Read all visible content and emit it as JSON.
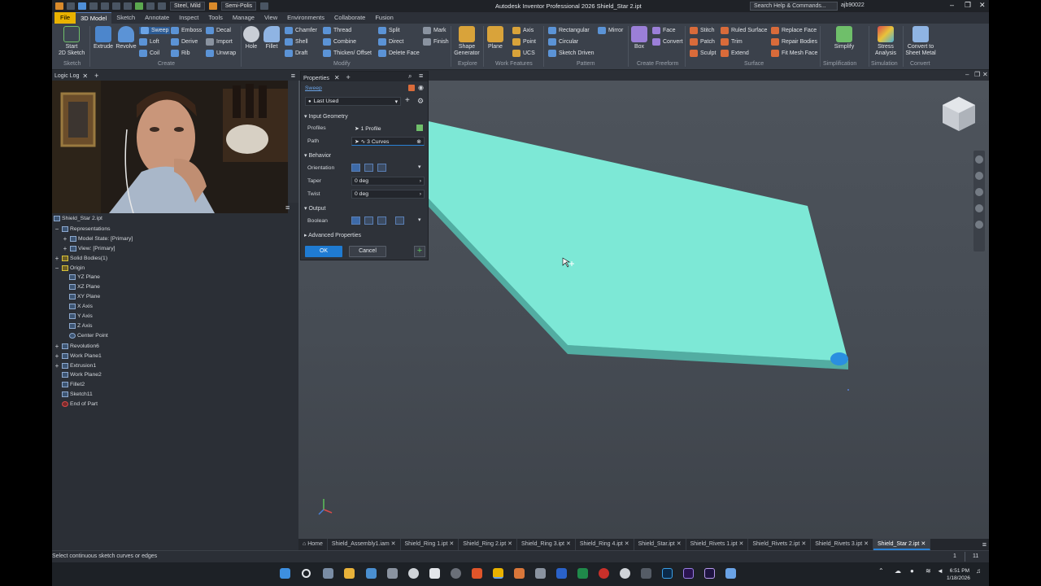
{
  "window": {
    "title": "Autodesk Inventor Professional 2026   Shield_Star 2.ipt",
    "material": "Steel, Mild",
    "appearance": "Semi-Polis",
    "search_placeholder": "Search Help & Commands...",
    "user": "ajb90022"
  },
  "menu_tabs": [
    "File",
    "3D Model",
    "Sketch",
    "Annotate",
    "Inspect",
    "Tools",
    "Manage",
    "View",
    "Environments",
    "Collaborate",
    "Fusion"
  ],
  "ribbon": {
    "sketch": {
      "start_sketch": "Start\n2D Sketch",
      "group": "Sketch"
    },
    "create": {
      "extrude": "Extrude",
      "revolve": "Revolve",
      "sweep": "Sweep",
      "loft": "Loft",
      "coil": "Coil",
      "emboss": "Emboss",
      "derive": "Derive",
      "rib": "Rib",
      "decal": "Decal",
      "import": "Import",
      "unwrap": "Unwrap",
      "group": "Create"
    },
    "modify": {
      "hole": "Hole",
      "fillet": "Fillet",
      "chamfer": "Chamfer",
      "shell": "Shell",
      "draft": "Draft",
      "thread": "Thread",
      "combine": "Combine",
      "thicken": "Thicken/ Offset",
      "split": "Split",
      "direct": "Direct",
      "delete_face": "Delete Face",
      "mark": "Mark",
      "finish": "Finish",
      "group": "Modify"
    },
    "explore": {
      "shape_generator": "Shape\nGenerator",
      "group": "Explore"
    },
    "work_features": {
      "plane": "Plane",
      "axis": "Axis",
      "point": "Point",
      "ucs": "UCS",
      "group": "Work Features"
    },
    "pattern": {
      "rectangular": "Rectangular",
      "circular": "Circular",
      "sketch_driven": "Sketch Driven",
      "mirror": "Mirror",
      "group": "Pattern"
    },
    "freeform": {
      "box": "Box",
      "face": "Face",
      "convert": "Convert",
      "group": "Create Freeform"
    },
    "surface": {
      "stitch": "Stitch",
      "patch": "Patch",
      "sculpt": "Sculpt",
      "ruled_surface": "Ruled Surface",
      "trim": "Trim",
      "extend": "Extend",
      "replace_face": "Replace Face",
      "repair_bodies": "Repair Bodies",
      "fit_mesh_face": "Fit Mesh Face",
      "group": "Surface"
    },
    "simplification": {
      "simplify": "Simplify",
      "group": "Simplification"
    },
    "simulation": {
      "stress": "Stress\nAnalysis",
      "group": "Simulation"
    },
    "convert": {
      "sheet_metal": "Convert to\nSheet Metal",
      "group": "Convert"
    }
  },
  "logic_log": {
    "tab": "Logic Log"
  },
  "browser": {
    "root": "Shield_Star 2.ipt",
    "items": [
      "Representations",
      "Model State: [Primary]",
      "View: [Primary]",
      "Solid Bodies(1)",
      "Origin",
      "YZ Plane",
      "XZ Plane",
      "XY Plane",
      "X Axis",
      "Y Axis",
      "Z Axis",
      "Center Point",
      "Revolution6",
      "Work Plane1",
      "Extrusion1",
      "Work Plane2",
      "Fillet2",
      "Sketch11",
      "End of Part"
    ]
  },
  "properties": {
    "tab": "Properties",
    "feature": "Sweep",
    "preset": "Last Used",
    "input_geometry": "Input Geometry",
    "profiles_label": "Profiles",
    "profiles_value": "1 Profile",
    "path_label": "Path",
    "path_value": "3 Curves",
    "behavior": "Behavior",
    "orientation_label": "Orientation",
    "taper_label": "Taper",
    "taper_value": "0 deg",
    "twist_label": "Twist",
    "twist_value": "0 deg",
    "output": "Output",
    "boolean_label": "Boolean",
    "advanced": "Advanced Properties",
    "ok": "OK",
    "cancel": "Cancel"
  },
  "doc_tabs": [
    "Home",
    "Shield_Assembly1.iam",
    "Shield_Ring 1.ipt",
    "Shield_Ring 2.ipt",
    "Shield_Ring 3.ipt",
    "Shield_Ring 4.ipt",
    "Shield_Star.ipt",
    "Shield_Rivets 1.ipt",
    "Shield_Rivets 2.ipt",
    "Shield_Rivets 3.ipt",
    "Shield_Star 2.ipt"
  ],
  "status": {
    "message": "Select continuous sketch curves or edges",
    "count_a": "1",
    "count_b": "11"
  },
  "taskbar": {
    "time": "6:51 PM",
    "date": "1/18/2026"
  },
  "colors": {
    "accent": "#1f7bd2",
    "model": "#7de8d6",
    "file_tab": "#e9b200"
  }
}
